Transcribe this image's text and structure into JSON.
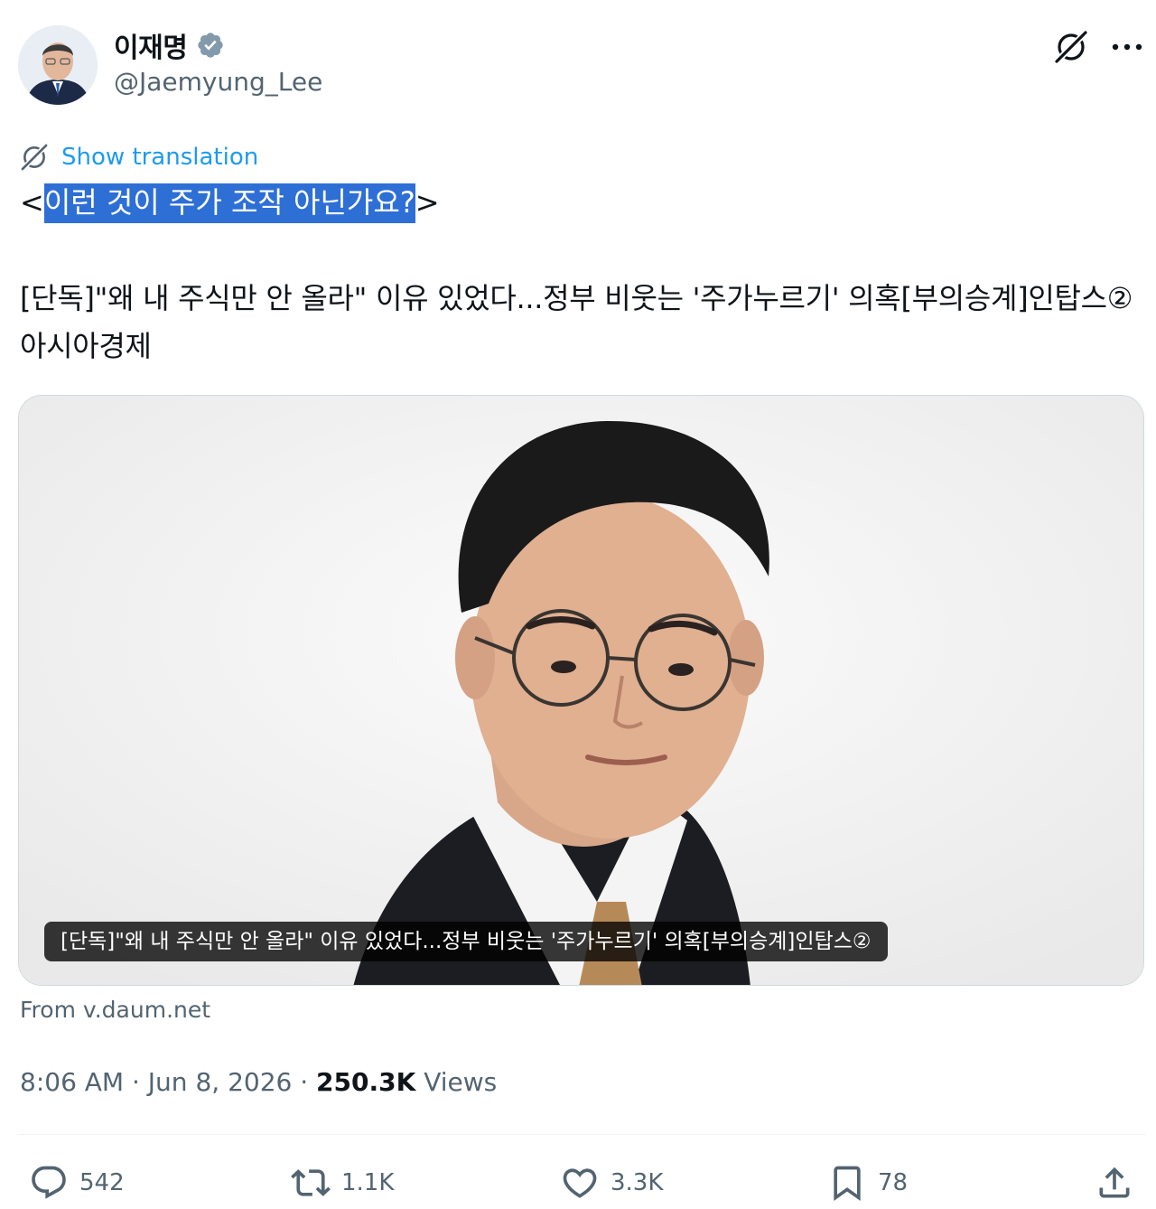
{
  "author": {
    "display_name": "이재명",
    "handle": "@Jaemyung_Lee",
    "avatar_icon": "profile-photo",
    "verified_icon": "verified-badge-icon"
  },
  "header_actions": {
    "grok_icon": "grok-icon",
    "more_icon": "more-icon"
  },
  "translation": {
    "label": "Show translation",
    "icon": "grok-icon"
  },
  "post": {
    "line1_prefix": "<",
    "line1_selected": "이런 것이 주가 조작 아닌가요?",
    "line1_suffix": ">",
    "body": "[단독]\"왜 내 주식만 안 올라\" 이유 있었다...정부 비웃는 '주가누르기' 의혹[부의승계]인탑스② 아시아경제"
  },
  "link_card": {
    "caption": "[단독]\"왜 내 주식만 안 올라\" 이유 있었다...정부 비웃는 '주가누르기' 의혹[부의승계]인탑스②",
    "source": "From v.daum.net"
  },
  "meta": {
    "time": "8:06 AM",
    "separator": " · ",
    "date": "Jun 8, 2026",
    "views_count": "250.3K",
    "views_label": " Views"
  },
  "actions": {
    "replies": "542",
    "reposts": "1.1K",
    "likes": "3.3K",
    "bookmarks": "78"
  },
  "colors": {
    "accent": "#1d9bf0",
    "selection": "#2e6fd6",
    "muted_text": "#536471",
    "verified_badge": "#829aab"
  }
}
